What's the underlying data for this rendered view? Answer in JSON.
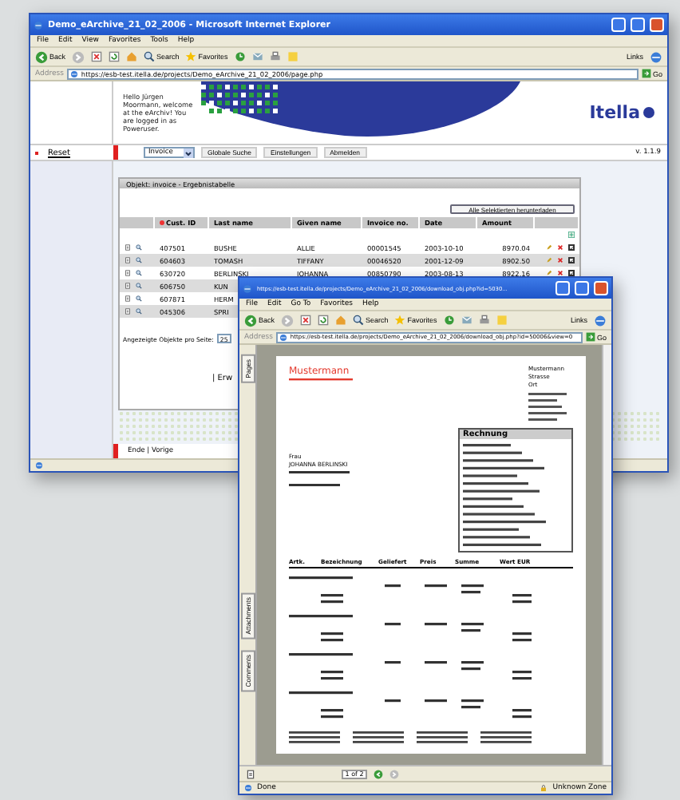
{
  "main_window": {
    "title": "Demo_eArchive_21_02_2006 - Microsoft Internet Explorer",
    "menu": [
      "File",
      "Edit",
      "View",
      "Favorites",
      "Tools",
      "Help"
    ],
    "toolbar": {
      "back": "Back",
      "search": "Search",
      "favorites": "Favorites",
      "links": "Links"
    },
    "address": {
      "label": "Address",
      "value": "https://esb-test.itella.de/projects/Demo_eArchive_21_02_2006/page.php",
      "go": "Go"
    },
    "header": {
      "greeting": "Hello Jürgen Moormann, welcome at the eArchiv! You are logged in as Poweruser.",
      "logo": "Itella"
    },
    "nav": {
      "reset": "Reset",
      "object_select": "Invoice",
      "buttons": [
        "Globale Suche",
        "Einstellungen",
        "Abmelden"
      ],
      "version": "v. 1.1.9"
    },
    "panel": {
      "title": "Objekt: invoice - Ergebnistabelle",
      "download_button": "Alle Selektierten herunterladen",
      "columns": [
        "Cust. ID",
        "Last name",
        "Given name",
        "Invoice no.",
        "Date",
        "Amount"
      ],
      "rows": [
        {
          "cells": [
            "407501",
            "BUSHE",
            "ALLIE",
            "00001545",
            "2003-10-10",
            "8970.04"
          ],
          "checked": true
        },
        {
          "cells": [
            "604603",
            "TOMASH",
            "TIFFANY",
            "00046520",
            "2001-12-09",
            "8902.50"
          ],
          "checked": true
        },
        {
          "cells": [
            "630720",
            "BERLINSKI",
            "JOHANNA",
            "00850790",
            "2003-08-13",
            "8922.16"
          ],
          "checked": true
        },
        {
          "cells": [
            "606750",
            "KUN"
          ]
        },
        {
          "cells": [
            "607871",
            "HERM"
          ]
        },
        {
          "cells": [
            "045306",
            "SPRI"
          ]
        }
      ],
      "per_page_label": "Angezeigte Objekte pro Seite:",
      "per_page_value": "25",
      "link": "| Erw"
    },
    "footer": "Ende | Vorige"
  },
  "popup_window": {
    "title": "https://esb-test.itella.de/projects/Demo_eArchive_21_02_2006/download_obj.php?id=5030...",
    "menu": [
      "File",
      "Edit",
      "Go To",
      "Favorites",
      "Help"
    ],
    "toolbar": {
      "back": "Back",
      "search": "Search",
      "favorites": "Favorites",
      "links": "Links"
    },
    "address": {
      "label": "Address",
      "value": "https://esb-test.itella.de/projects/Demo_eArchive_21_02_2006/download_obj.php?id=50006&view=0",
      "go": "Go"
    },
    "side_tabs": [
      "Pages",
      "Attachments",
      "Comments"
    ],
    "document": {
      "sender": "Mustermann",
      "sender_address": [
        "Mustermann",
        "Strasse",
        "Ort"
      ],
      "recipient": [
        "Frau",
        "JOHANNA BERLINSKI"
      ],
      "invoice_title": "Rechnung",
      "columns": [
        "Artk.",
        "Bezeichnung",
        "Geliefert",
        "Preis",
        "Summe",
        "Wert EUR"
      ]
    },
    "page_indicator": "1 of 2",
    "status": {
      "text": "Done",
      "zone": "Unknown Zone"
    }
  }
}
